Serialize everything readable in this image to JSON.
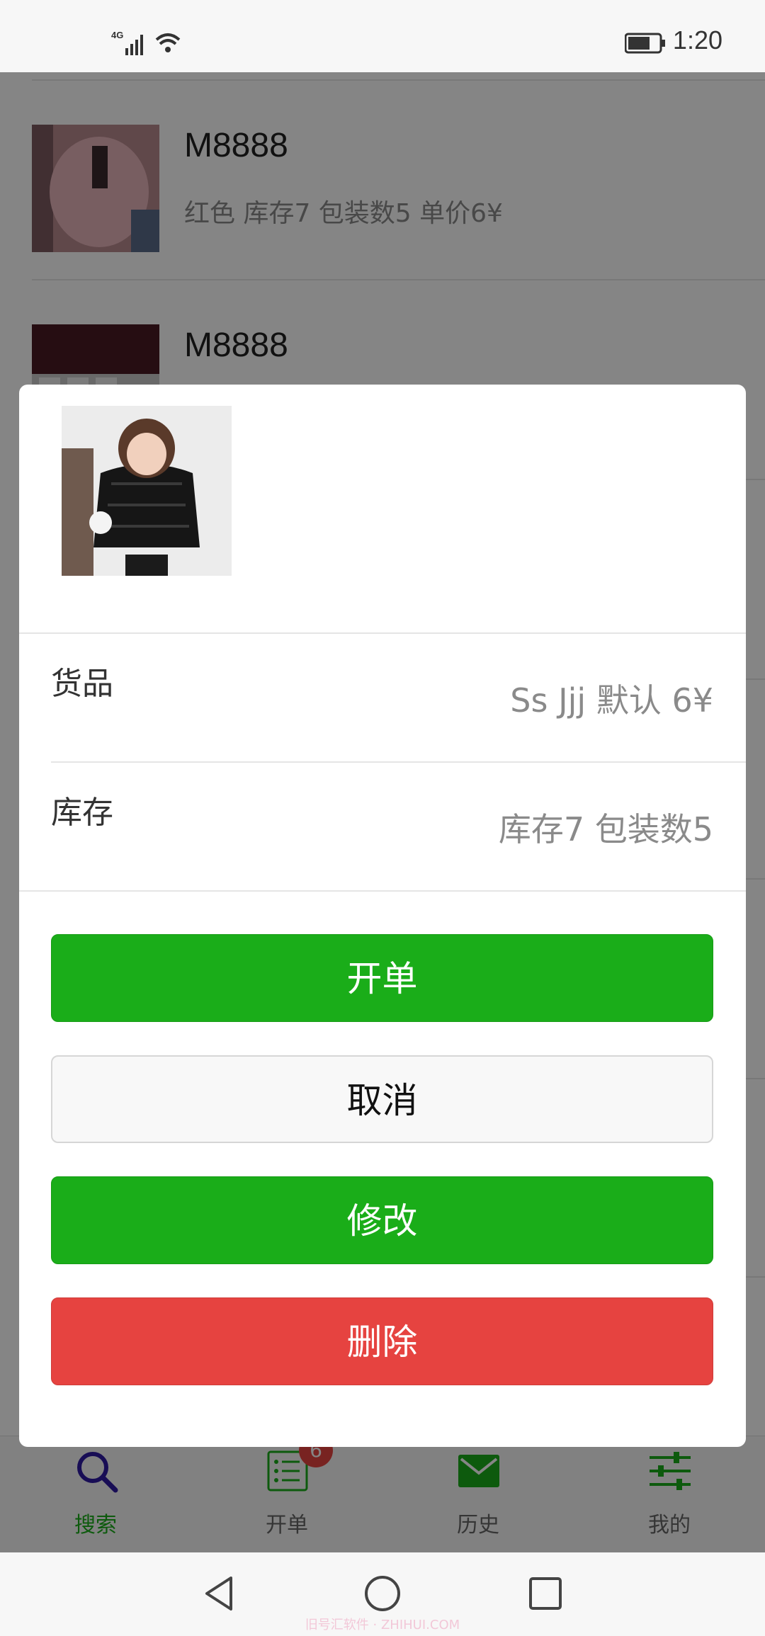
{
  "status": {
    "time": "1:20",
    "network": "4G"
  },
  "list": {
    "items": [
      {
        "title": "M8888",
        "subtitle": "红色 库存7 包装数5 单价6¥"
      },
      {
        "title": "M8888",
        "subtitle": ""
      }
    ]
  },
  "dialog": {
    "rows": [
      {
        "label": "货品",
        "value": "Ss Jjj 默认 6¥"
      },
      {
        "label": "库存",
        "value": "库存7 包装数5"
      }
    ],
    "buttons": {
      "open_order": "开单",
      "cancel": "取消",
      "edit": "修改",
      "delete": "删除"
    }
  },
  "tabbar": {
    "items": [
      {
        "label": "搜索",
        "icon": "search-icon",
        "active": true
      },
      {
        "label": "开单",
        "icon": "list-icon",
        "badge": "6"
      },
      {
        "label": "历史",
        "icon": "mail-icon"
      },
      {
        "label": "我的",
        "icon": "sliders-icon"
      }
    ]
  },
  "watermark": "旧号汇软件 · ZHIHUI.COM",
  "colors": {
    "primary_green": "#1aad19",
    "danger_red": "#e64340",
    "active_tab_icon": "#2f1aa3"
  }
}
